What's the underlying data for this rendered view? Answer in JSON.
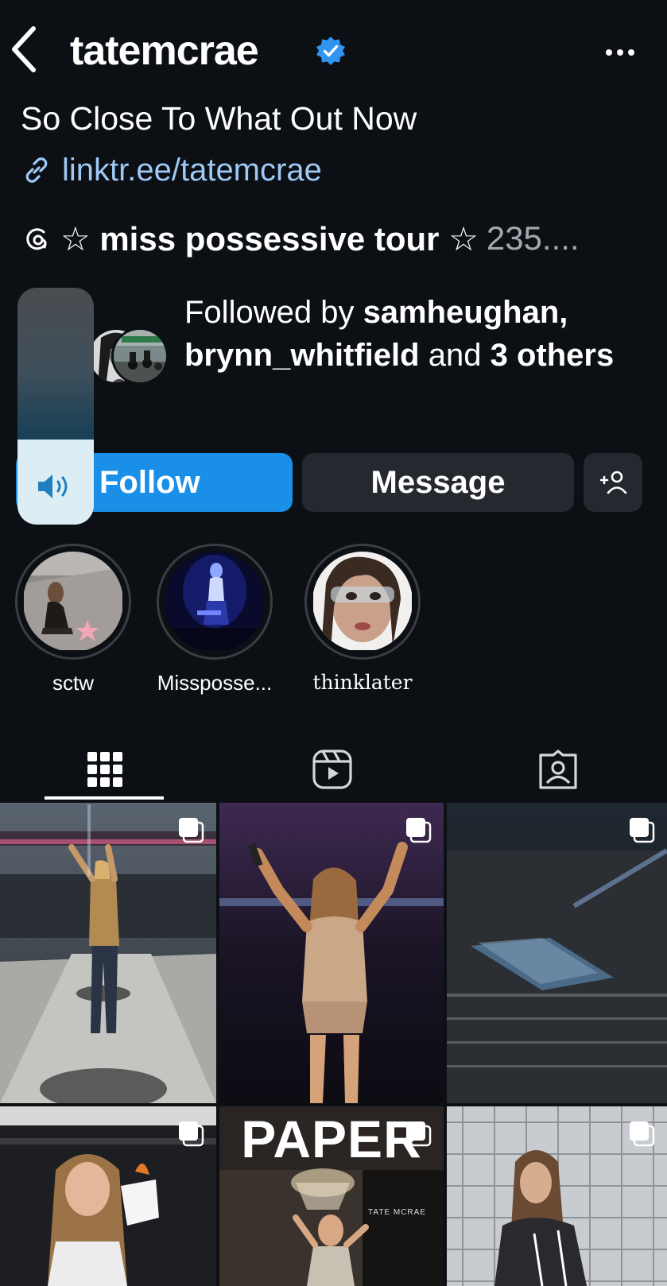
{
  "header": {
    "username": "tatemcrae",
    "verified": true,
    "back_icon": "chevron-left-icon",
    "more_icon": "ellipsis-icon"
  },
  "bio": {
    "text": "So Close To What Out Now",
    "link_icon": "link-icon",
    "link": "linktr.ee/tatemcrae",
    "threads_icon": "threads-icon",
    "threads_text": "☆ miss possessive tour ☆",
    "threads_count": "235...."
  },
  "followed_by": {
    "prefix": "Followed by",
    "user1": "samheughan,",
    "user2": "brynn_whitfield",
    "middle": "and",
    "count": "3",
    "suffix": "others"
  },
  "buttons": {
    "follow": "Follow",
    "message": "Message",
    "suggest_icon": "add-person-icon"
  },
  "volume": {
    "level": 0.36,
    "icon": "speaker-icon"
  },
  "highlights": [
    {
      "label": "sctw"
    },
    {
      "label": "Misspossе..."
    },
    {
      "label": "thinklater"
    }
  ],
  "tabs": [
    {
      "icon": "grid-icon",
      "active": true
    },
    {
      "icon": "reels-icon",
      "active": false
    },
    {
      "icon": "tagged-icon",
      "active": false
    }
  ],
  "posts": {
    "paper_title": "PAPER",
    "paper_subtitle": "TATE MCRAE",
    "multi_icon": "carousel-icon"
  },
  "colors": {
    "background": "#0c0f14",
    "follow_blue": "#1a8fe8",
    "link_blue": "#9ec8f5",
    "button_gray": "#25282e"
  }
}
